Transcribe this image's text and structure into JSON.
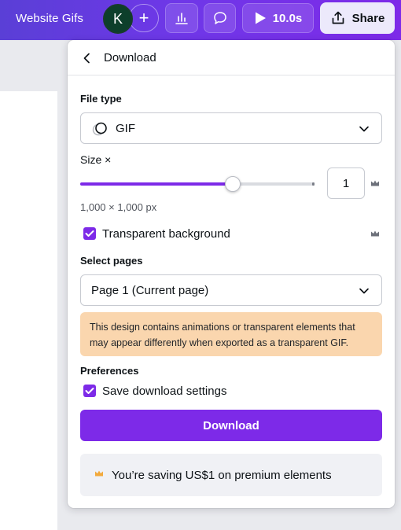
{
  "topbar": {
    "design_title": "Website Gifs",
    "avatar_initial": "K",
    "add_label": "+",
    "play_duration": "10.0s",
    "share_label": "Share"
  },
  "panel": {
    "title": "Download",
    "file_type": {
      "label": "File type",
      "value": "GIF"
    },
    "size": {
      "label": "Size ×",
      "value": "1",
      "slider_fraction": 0.65,
      "dimensions": "1,000 × 1,000 px"
    },
    "transparent_background": {
      "label": "Transparent background",
      "checked": true
    },
    "select_pages": {
      "label": "Select pages",
      "value": "Page 1 (Current page)"
    },
    "notice": "This design contains animations or transparent elements that may appear differently when exported as a transparent GIF.",
    "preferences": {
      "label": "Preferences",
      "save_settings_label": "Save download settings",
      "checked": true
    },
    "download_button": "Download",
    "saving_message": "You’re saving US$1 on premium elements"
  },
  "colors": {
    "accent": "#7d2ae8",
    "notice_bg": "#fad6ae",
    "crown": "#f2a93b"
  }
}
